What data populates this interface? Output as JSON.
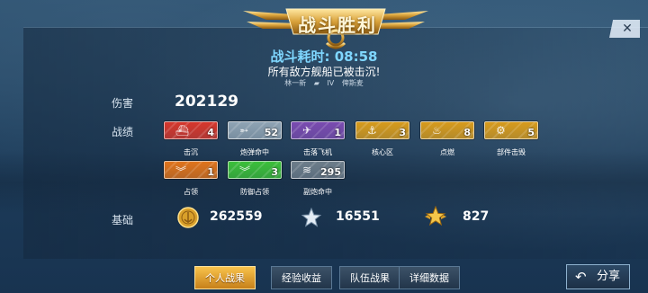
{
  "header": {
    "title": "战斗胜利",
    "close_label": "✕",
    "time_label": "战斗耗时:",
    "time_value": "08:58",
    "result_text": "所有敌方舰船已被击沉!",
    "ship_commander": "林一新",
    "ship_tier": "IV",
    "ship_name": "俾斯麦"
  },
  "damage": {
    "label": "伤害",
    "value": "202129"
  },
  "achievements": {
    "label": "战绩",
    "items": [
      {
        "label": "击沉",
        "count": "4",
        "color": "#d6372c",
        "icon": "ship-icon"
      },
      {
        "label": "炮弹命中",
        "count": "52",
        "color": "#8fa3b3",
        "icon": "shell-icon"
      },
      {
        "label": "击落飞机",
        "count": "1",
        "color": "#7a4bb0",
        "icon": "plane-icon"
      },
      {
        "label": "核心区",
        "count": "3",
        "color": "#d79b1c",
        "icon": "citadel-icon"
      },
      {
        "label": "点燃",
        "count": "8",
        "color": "#d79b1c",
        "icon": "fire-icon"
      },
      {
        "label": "部件击毁",
        "count": "5",
        "color": "#d79b1c",
        "icon": "gear-icon"
      },
      {
        "label": "占领",
        "count": "1",
        "color": "#e0741c",
        "icon": "chevron-icon"
      },
      {
        "label": "防御占领",
        "count": "3",
        "color": "#3cbf3a",
        "icon": "chevron-icon"
      },
      {
        "label": "副炮命中",
        "count": "295",
        "color": "#6d7d8a",
        "icon": "secondary-icon"
      }
    ]
  },
  "base": {
    "label": "基础",
    "credits": "262559",
    "xp": "16551",
    "commander_xp": "827"
  },
  "tabs": [
    {
      "label": "个人战果",
      "active": true
    },
    {
      "label": "经验收益",
      "active": false
    },
    {
      "label": "队伍战果",
      "active": false
    },
    {
      "label": "详细数据",
      "active": false
    }
  ],
  "share_label": "分享"
}
